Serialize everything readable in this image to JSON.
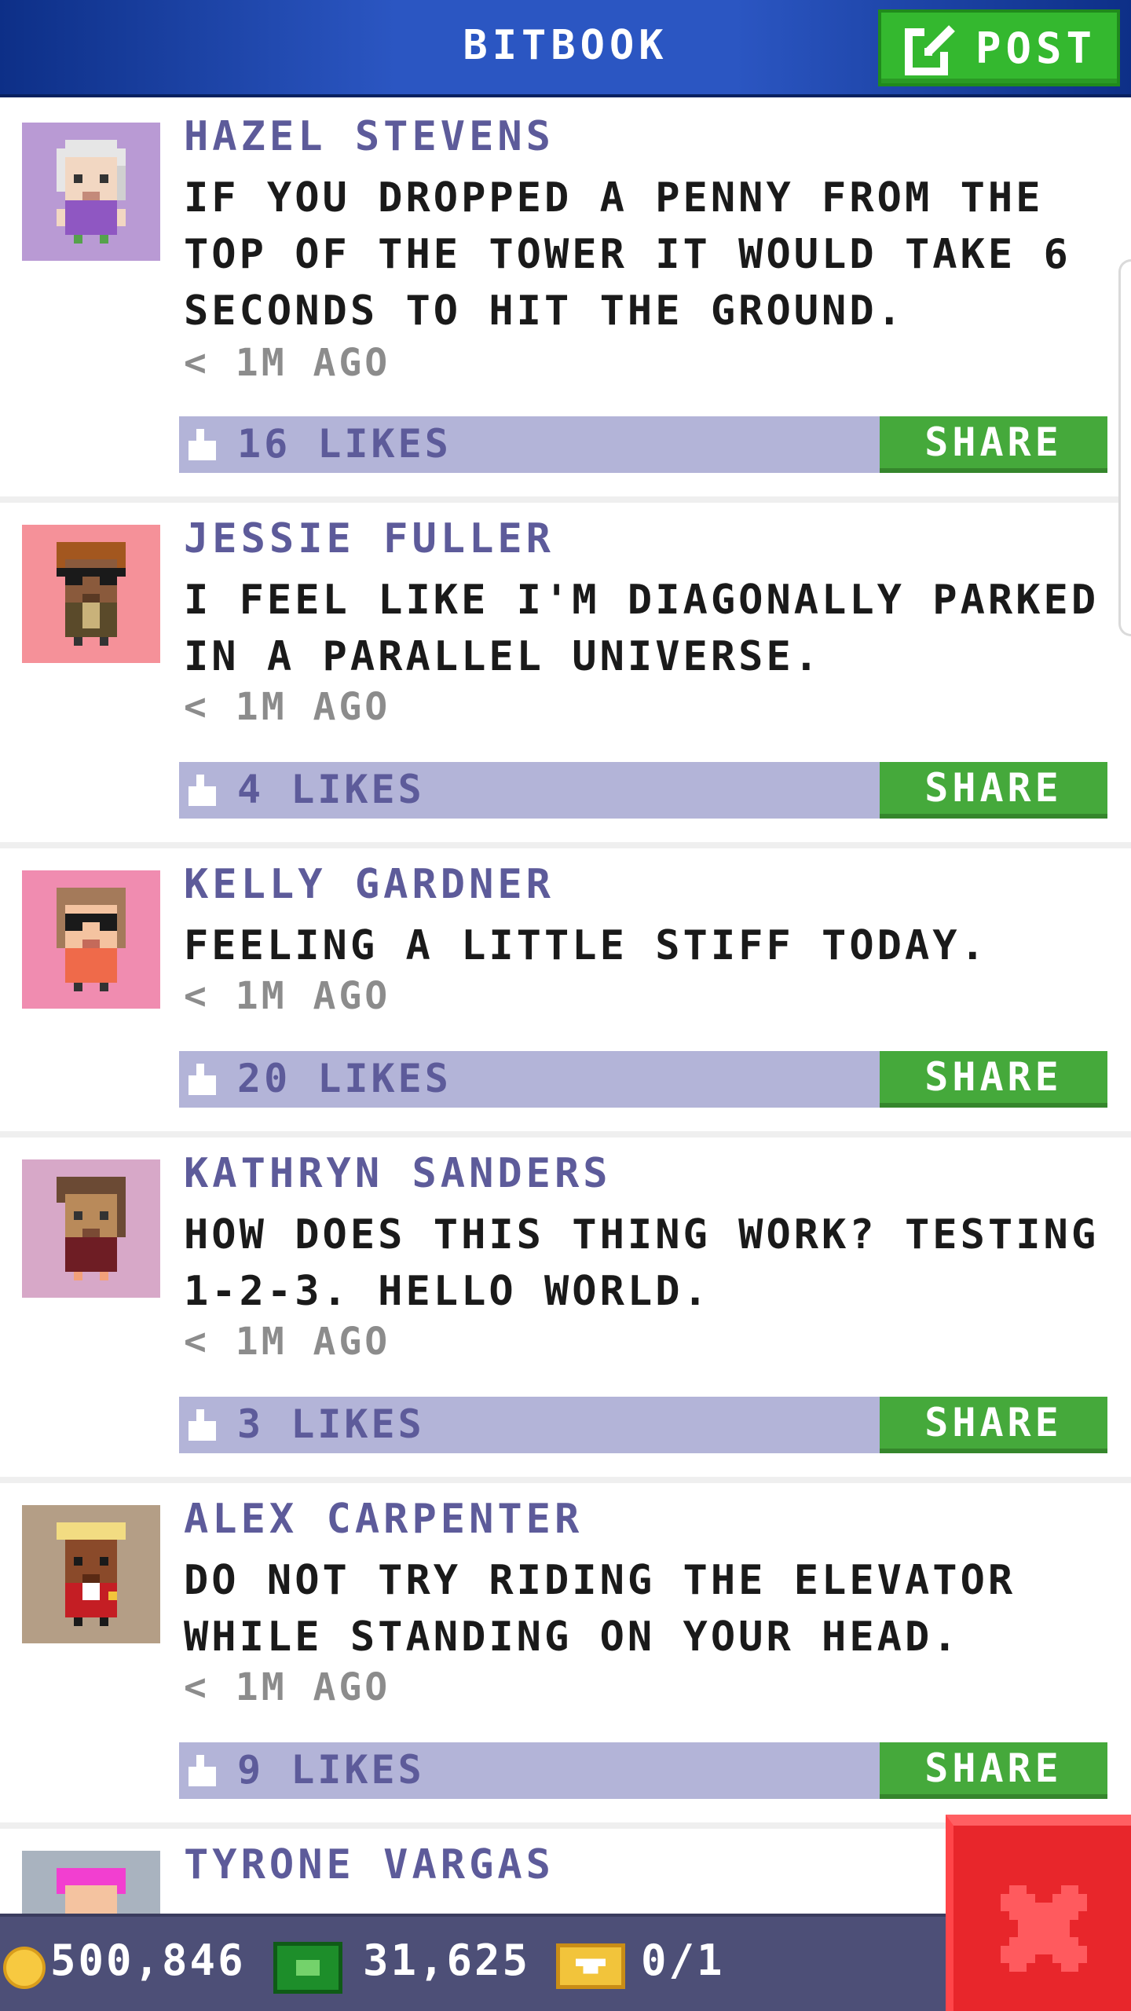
{
  "header": {
    "title": "BITBOOK",
    "post_label": "POST",
    "post_icon": "edit-icon"
  },
  "posts": [
    {
      "name": "HAZEL STEVENS",
      "message": "IF YOU DROPPED A PENNY FROM THE TOP OF THE TOWER IT WOULD TAKE 6 SECONDS TO HIT THE GROUND.",
      "time": "< 1M AGO",
      "likes": "16 LIKES",
      "share": "SHARE",
      "avatar_bg": "#b99ad4"
    },
    {
      "name": "JESSIE FULLER",
      "message": "I FEEL LIKE I'M DIAGONALLY PARKED IN A PARALLEL UNIVERSE.",
      "time": "< 1M AGO",
      "likes": "4 LIKES",
      "share": "SHARE",
      "avatar_bg": "#f59199"
    },
    {
      "name": "KELLY GARDNER",
      "message": "FEELING A LITTLE STIFF TODAY.",
      "time": "< 1M AGO",
      "likes": "20 LIKES",
      "share": "SHARE",
      "avatar_bg": "#f08cb0"
    },
    {
      "name": "KATHRYN SANDERS",
      "message": "HOW DOES THIS THING WORK? TESTING 1-2-3. HELLO WORLD.",
      "time": "< 1M AGO",
      "likes": "3 LIKES",
      "share": "SHARE",
      "avatar_bg": "#d7a8c8"
    },
    {
      "name": "ALEX CARPENTER",
      "message": "DO NOT TRY RIDING THE ELEVATOR WHILE STANDING ON YOUR HEAD.",
      "time": "< 1M AGO",
      "likes": "9 LIKES",
      "share": "SHARE",
      "avatar_bg": "#b49e86"
    },
    {
      "name": "TYRONE VARGAS",
      "avatar_bg": "#a9b3bf"
    }
  ],
  "status": {
    "coins": "500,846",
    "bux": "31,625",
    "tickets": "0/1",
    "coin_icon": "coin-icon",
    "bux_icon": "cash-icon",
    "ticket_icon": "ticket-icon"
  },
  "colors": {
    "header_blue": "#2b56c2",
    "accent_green": "#45a93b",
    "like_bar": "#b3b4d8",
    "name_purple": "#5d5b9a",
    "close_red": "#e8262b"
  }
}
